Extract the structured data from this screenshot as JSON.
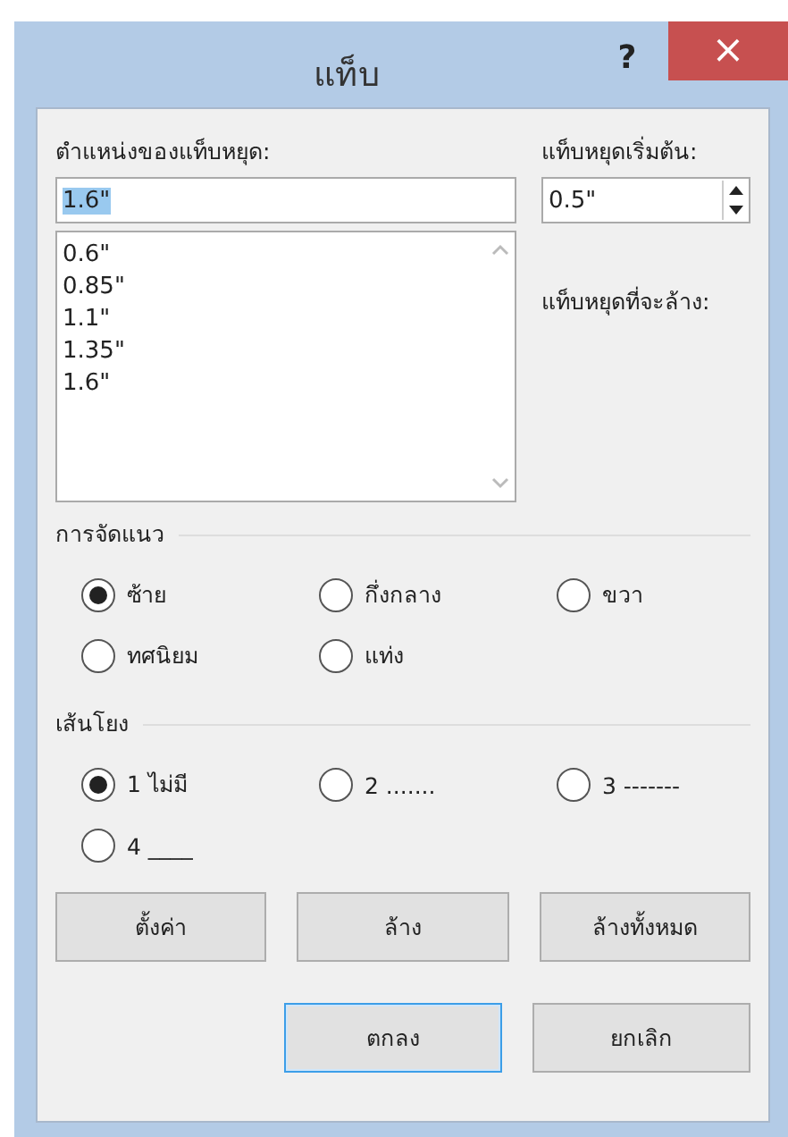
{
  "window": {
    "title": "แท็บ",
    "help": "?",
    "close": "×"
  },
  "tab_stop_position": {
    "label": "ตำแหน่งของแท็บหยุด:",
    "value": "1.6\"",
    "list": [
      "0.6\"",
      "0.85\"",
      "1.1\"",
      "1.35\"",
      "1.6\""
    ]
  },
  "default_tab_stops": {
    "label": "แท็บหยุดเริ่มต้น:",
    "value": "0.5\""
  },
  "tab_stops_to_clear": {
    "label": "แท็บหยุดที่จะล้าง:"
  },
  "alignment": {
    "title": "การจัดแนว",
    "options": [
      {
        "label": "ซ้าย",
        "selected": true
      },
      {
        "label": "กึ่งกลาง",
        "selected": false
      },
      {
        "label": "ขวา",
        "selected": false
      },
      {
        "label": "ทศนิยม",
        "selected": false
      },
      {
        "label": "แท่ง",
        "selected": false
      }
    ]
  },
  "leader": {
    "title": "เส้นโยง",
    "options": [
      {
        "label": "1 ไม่มี",
        "selected": true
      },
      {
        "label": "2 .......",
        "selected": false
      },
      {
        "label": "3 -------",
        "selected": false
      },
      {
        "label": "4 ____",
        "selected": false
      }
    ]
  },
  "action_buttons": [
    "ตั้งค่า",
    "ล้าง",
    "ล้างทั้งหมด"
  ],
  "dialog_buttons": [
    {
      "label": "ตกลง",
      "default": true
    },
    {
      "label": "ยกเลิก",
      "default": false
    }
  ]
}
